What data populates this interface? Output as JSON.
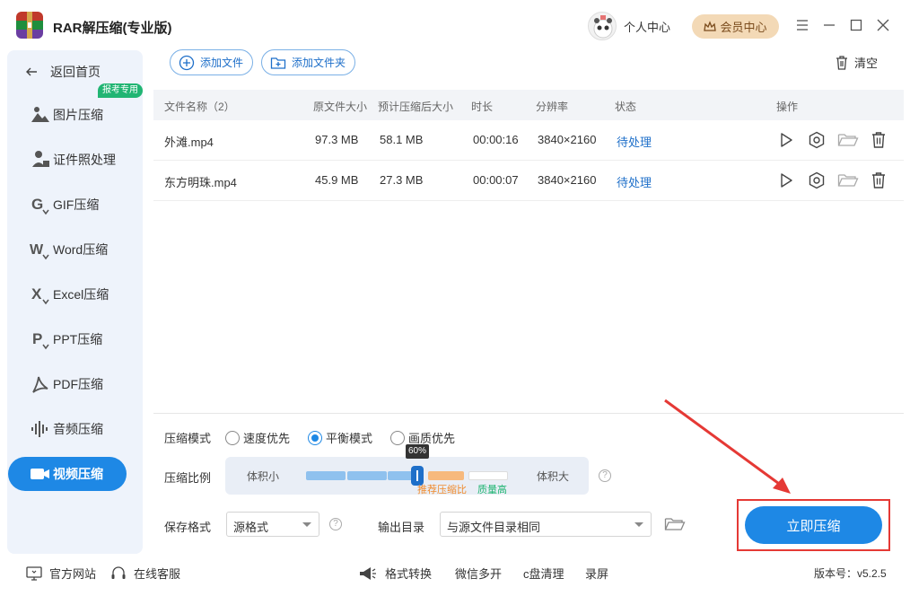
{
  "app": {
    "title": "RAR解压缩(专业版)"
  },
  "header": {
    "user_center": "个人中心",
    "vip_center": "会员中心"
  },
  "sidebar": {
    "back": "返回首页",
    "items": [
      {
        "label": "图片压缩",
        "icon": "image-icon"
      },
      {
        "label": "证件照处理",
        "icon": "id-photo-icon",
        "badge": "报考专用"
      },
      {
        "label": "GIF压缩",
        "icon": "gif-icon"
      },
      {
        "label": "Word压缩",
        "icon": "word-icon"
      },
      {
        "label": "Excel压缩",
        "icon": "excel-icon"
      },
      {
        "label": "PPT压缩",
        "icon": "ppt-icon"
      },
      {
        "label": "PDF压缩",
        "icon": "pdf-icon"
      },
      {
        "label": "音频压缩",
        "icon": "audio-icon"
      },
      {
        "label": "视频压缩",
        "icon": "video-icon",
        "active": true
      }
    ]
  },
  "toolbar": {
    "add_file": "添加文件",
    "add_folder": "添加文件夹",
    "clear": "清空"
  },
  "table": {
    "headers": [
      "文件名称（2）",
      "原文件大小",
      "预计压缩后大小",
      "时长",
      "分辨率",
      "状态",
      "操作"
    ],
    "rows": [
      {
        "name": "外滩.mp4",
        "size": "97.3 MB",
        "compressed": "58.1 MB",
        "duration": "00:00:16",
        "resolution": "3840×2160",
        "status": "待处理"
      },
      {
        "name": "东方明珠.mp4",
        "size": "45.9 MB",
        "compressed": "27.3 MB",
        "duration": "00:00:07",
        "resolution": "3840×2160",
        "status": "待处理"
      }
    ]
  },
  "settings": {
    "mode_label": "压缩模式",
    "modes": [
      "速度优先",
      "平衡模式",
      "画质优先"
    ],
    "selected_mode": "平衡模式",
    "ratio_label": "压缩比例",
    "ratio_small": "体积小",
    "ratio_large": "体积大",
    "ratio_value": "60%",
    "recommend_label": "推荐压缩比",
    "quality_label": "质量高",
    "format_label": "保存格式",
    "format_value": "源格式",
    "output_label": "输出目录",
    "output_value": "与源文件目录相同",
    "compress_button": "立即压缩"
  },
  "footer": {
    "website": "官方网站",
    "support": "在线客服",
    "format_convert": "格式转换",
    "wechat_multi": "微信多开",
    "c_clean": "c盘清理",
    "record": "录屏",
    "version": "版本号：v5.2.5"
  },
  "colors": {
    "accent": "#1e88e5",
    "status": "#1e6fc9",
    "badge": "#21b573",
    "highlight_box": "#e53935",
    "vip": "#f3d9b6"
  }
}
